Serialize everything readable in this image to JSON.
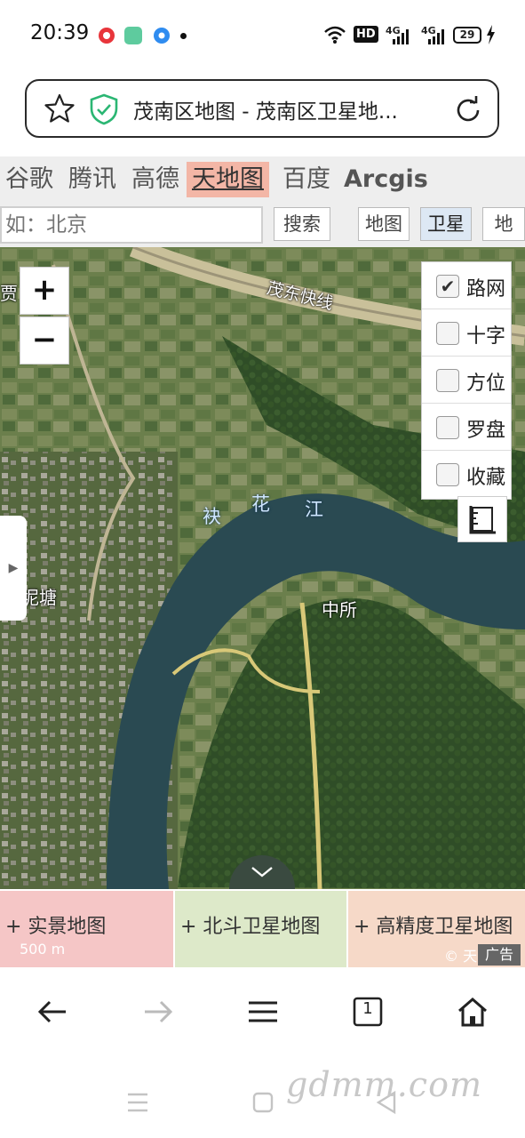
{
  "status_bar": {
    "time": "20:39",
    "network_badges": [
      "HD",
      "4G",
      "4G"
    ],
    "battery": "29"
  },
  "url_bar": {
    "title": "茂南区地图 - 茂南区卫星地..."
  },
  "providers": [
    {
      "label": "谷歌",
      "active": false
    },
    {
      "label": "腾讯",
      "active": false
    },
    {
      "label": "高德",
      "active": false
    },
    {
      "label": "天地图",
      "active": true
    },
    {
      "label": "百度",
      "active": false
    },
    {
      "label": "Arcgis",
      "active": false
    }
  ],
  "search": {
    "placeholder": "如：北京",
    "button_label": "搜索",
    "map_type_map": "地图",
    "map_type_satellite": "卫星",
    "map_type_partial": "地"
  },
  "map": {
    "zoom_in": "+",
    "zoom_out": "−",
    "labels": {
      "road": "茂东快线",
      "river_1": "袂",
      "river_2": "花",
      "river_3": "江",
      "village": "中所",
      "pond": "坭塘",
      "edge_left": "贾"
    },
    "layers": [
      {
        "label": "路网",
        "checked": true
      },
      {
        "label": "十字",
        "checked": false
      },
      {
        "label": "方位",
        "checked": false
      },
      {
        "label": "罗盘",
        "checked": false
      },
      {
        "label": "收藏",
        "checked": false
      }
    ],
    "check_mark": "✔"
  },
  "bottom_links": {
    "realscene": "+ 实景地图",
    "beidou": "+ 北斗卫星地图",
    "hires": "+ 高精度卫星地图",
    "scale": "500 m",
    "ad": "广告",
    "tian_partial": "© 天"
  },
  "watermark": "gdmm.com",
  "tab_count": "1"
}
